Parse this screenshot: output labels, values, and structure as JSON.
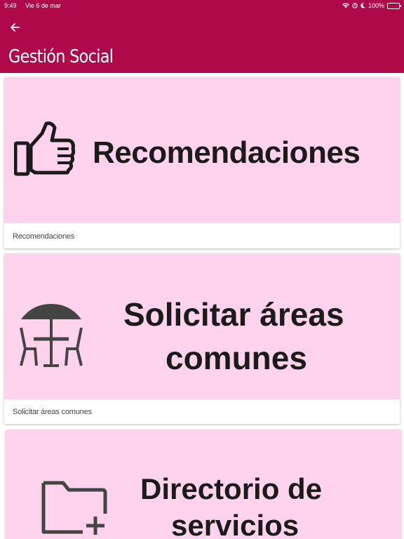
{
  "status_bar": {
    "time": "9:49",
    "date": "Vie 6 de mar",
    "battery": "100%",
    "battery_level": 1.0
  },
  "app_bar": {
    "back_icon": "arrow-left-icon",
    "title": "Gestión Social",
    "color": "#b0094a"
  },
  "cards": [
    {
      "image_text_lines": [
        "Recomendaciones"
      ],
      "icon": "thumbs-up-icon",
      "caption": "Recomendaciones"
    },
    {
      "image_text_lines": [
        "Solicitar áreas",
        "comunes"
      ],
      "icon": "patio-table-umbrella-icon",
      "caption": "Solicitar áreas comunes"
    },
    {
      "image_text_lines": [
        "Directorio de",
        "servicios"
      ],
      "icon": "folder-add-icon",
      "caption": ""
    }
  ],
  "colors": {
    "card_image_bg": "#ffd3ec",
    "battery_green": "#37d058"
  }
}
